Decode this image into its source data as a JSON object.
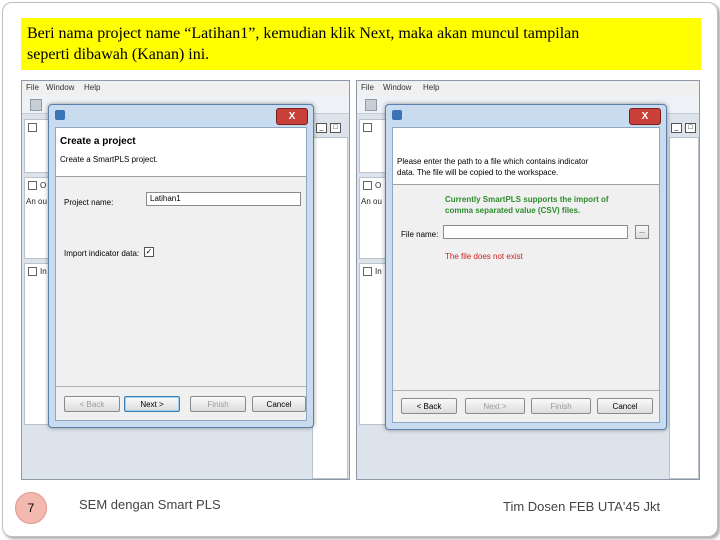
{
  "banner": {
    "line1": "Beri nama project name “Latihan1”, kemudian klik Next, maka akan muncul tampilan",
    "line2": "seperti  dibawah (Kanan) ini."
  },
  "ide": {
    "menu_file": "File",
    "menu_window": "Window",
    "menu_help": "Help",
    "pane_label_ob": "O",
    "pane_label_anou": "An ou",
    "pane_label_in": "In"
  },
  "dialog_left": {
    "close": "X",
    "header_title": "Create a project",
    "header_sub": "Create a SmartPLS project.",
    "project_name_label": "Project name:",
    "project_name_value": "Latihan1",
    "import_label": "Import indicator data:",
    "import_checked": "✓",
    "buttons": {
      "back": "< Back",
      "next": "Next >",
      "finish": "Finish",
      "cancel": "Cancel"
    }
  },
  "dialog_right": {
    "close": "X",
    "msg_line1": "Please enter the path to a file which contains indicator",
    "msg_line2": "data. The file will be copied to the workspace.",
    "info_line1": "Currently SmartPLS supports the import of",
    "info_line2": "comma separated value (CSV) files.",
    "file_label": "File name:",
    "browse": "...",
    "error": "The file does not exist",
    "buttons": {
      "back": "< Back",
      "next": "Next >",
      "finish": "Finish",
      "cancel": "Cancel"
    }
  },
  "footer": {
    "slide_number": "7",
    "left": "SEM dengan Smart PLS",
    "right": "Tim Dosen FEB UTA'45 Jkt"
  },
  "colors": {
    "banner": "#ffff00",
    "close_button": "#c9403a",
    "info_text": "#2e8b2e",
    "error_text": "#d02020"
  }
}
